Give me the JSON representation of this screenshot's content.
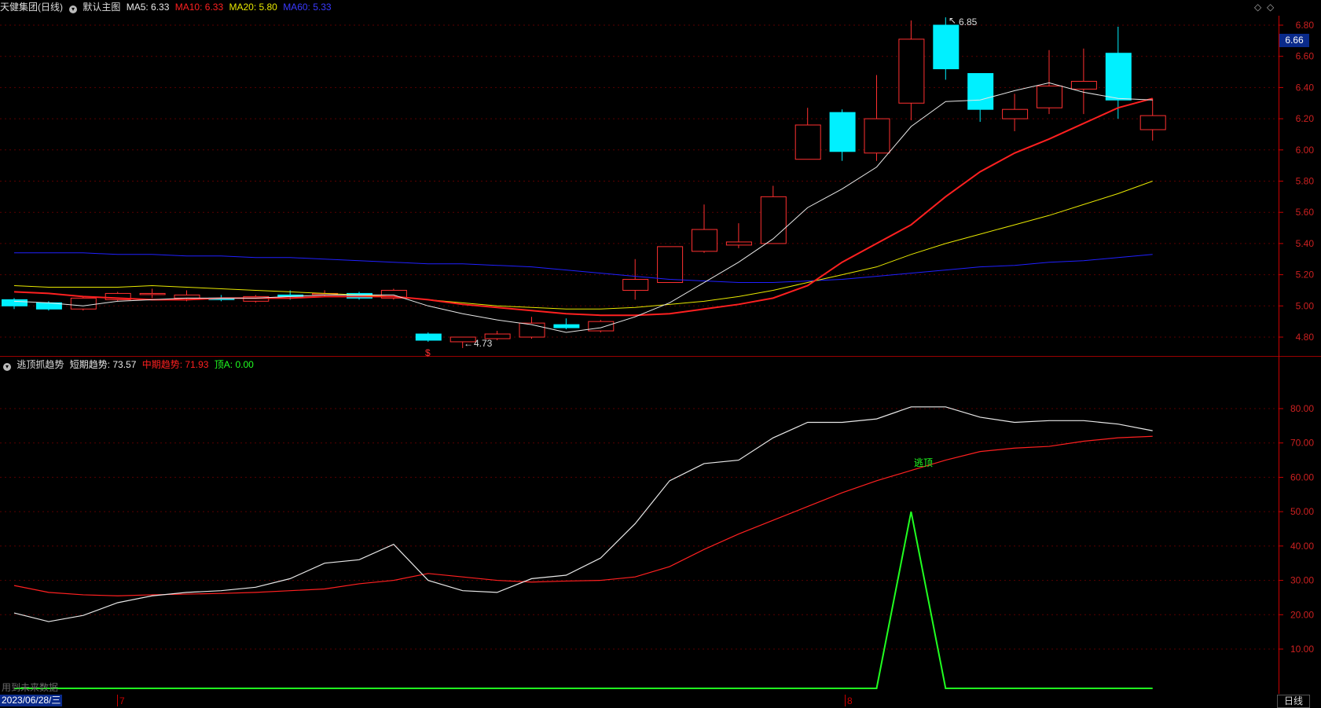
{
  "main_header": {
    "title": "天健集团(日线)",
    "indicator_name": "默认主图",
    "ma5": "MA5: 6.33",
    "ma10": "MA10: 6.33",
    "ma20": "MA20: 5.80",
    "ma60": "MA60: 5.33"
  },
  "sub_header": {
    "indicator_name": "逃顶抓趋势",
    "short_trend": "短期趋势: 73.57",
    "mid_trend": "中期趋势: 71.93",
    "top_a": "顶A: 0.00"
  },
  "colors": {
    "ma5": "#e8e8e8",
    "ma10": "#ff2020",
    "ma20": "#e8e800",
    "ma60": "#2020ff",
    "up": "#ff3030",
    "down": "#00f0ff",
    "signal": "#20ff20",
    "axis": "#cc0000"
  },
  "icons": [
    "chevron-down-icon",
    "diamond-icon"
  ],
  "price_axis_labels": [
    "6.80",
    "6.60",
    "6.40",
    "6.20",
    "6.00",
    "5.80",
    "5.60",
    "5.40",
    "5.20",
    "5.00",
    "4.80"
  ],
  "indicator_axis_labels": [
    "80.00",
    "70.00",
    "60.00",
    "50.00",
    "40.00",
    "30.00",
    "20.00",
    "10.00"
  ],
  "current_price_tag": "6.66",
  "high_marker": "6.85",
  "low_marker": "4.73",
  "low_signal_mark": "$",
  "signal_label": "逃顶",
  "footer_text": "用到未来数据",
  "date_label": "2023/06/28/三",
  "month_marks": [
    "7",
    "8"
  ],
  "period_button": "日线",
  "chart_data": [
    {
      "type": "candlestick",
      "ylim": [
        4.66,
        6.86
      ],
      "candles": [
        {
          "o": 5.04,
          "c": 5.0,
          "h": 5.05,
          "l": 4.98
        },
        {
          "o": 5.02,
          "c": 4.98,
          "h": 5.03,
          "l": 4.97
        },
        {
          "o": 4.98,
          "c": 5.05,
          "h": 5.06,
          "l": 4.97
        },
        {
          "o": 5.04,
          "c": 5.08,
          "h": 5.09,
          "l": 5.03
        },
        {
          "o": 5.08,
          "c": 5.08,
          "h": 5.11,
          "l": 5.05
        },
        {
          "o": 5.05,
          "c": 5.07,
          "h": 5.1,
          "l": 5.03
        },
        {
          "o": 5.05,
          "c": 5.04,
          "h": 5.07,
          "l": 5.03
        },
        {
          "o": 5.03,
          "c": 5.06,
          "h": 5.07,
          "l": 5.02
        },
        {
          "o": 5.07,
          "c": 5.06,
          "h": 5.1,
          "l": 5.04
        },
        {
          "o": 5.08,
          "c": 5.08,
          "h": 5.1,
          "l": 5.06
        },
        {
          "o": 5.08,
          "c": 5.05,
          "h": 5.09,
          "l": 5.04
        },
        {
          "o": 5.05,
          "c": 5.1,
          "h": 5.11,
          "l": 5.04
        },
        {
          "o": 4.82,
          "c": 4.78,
          "h": 4.83,
          "l": 4.77
        },
        {
          "o": 4.77,
          "c": 4.8,
          "h": 4.8,
          "l": 4.73
        },
        {
          "o": 4.79,
          "c": 4.82,
          "h": 4.84,
          "l": 4.78
        },
        {
          "o": 4.8,
          "c": 4.89,
          "h": 4.93,
          "l": 4.79
        },
        {
          "o": 4.88,
          "c": 4.86,
          "h": 4.92,
          "l": 4.85
        },
        {
          "o": 4.84,
          "c": 4.9,
          "h": 4.91,
          "l": 4.83
        },
        {
          "o": 5.1,
          "c": 5.17,
          "h": 5.3,
          "l": 5.04
        },
        {
          "o": 5.15,
          "c": 5.38,
          "h": 5.38,
          "l": 5.15
        },
        {
          "o": 5.35,
          "c": 5.49,
          "h": 5.65,
          "l": 5.34
        },
        {
          "o": 5.39,
          "c": 5.41,
          "h": 5.53,
          "l": 5.37
        },
        {
          "o": 5.4,
          "c": 5.7,
          "h": 5.77,
          "l": 5.4
        },
        {
          "o": 5.94,
          "c": 6.16,
          "h": 6.27,
          "l": 5.94
        },
        {
          "o": 6.24,
          "c": 5.99,
          "h": 6.26,
          "l": 5.93
        },
        {
          "o": 5.98,
          "c": 6.2,
          "h": 6.48,
          "l": 5.93
        },
        {
          "o": 6.3,
          "c": 6.71,
          "h": 6.83,
          "l": 6.19
        },
        {
          "o": 6.8,
          "c": 6.52,
          "h": 6.85,
          "l": 6.45
        },
        {
          "o": 6.49,
          "c": 6.26,
          "h": 6.49,
          "l": 6.18
        },
        {
          "o": 6.2,
          "c": 6.26,
          "h": 6.36,
          "l": 6.12
        },
        {
          "o": 6.27,
          "c": 6.41,
          "h": 6.64,
          "l": 6.23
        },
        {
          "o": 6.39,
          "c": 6.44,
          "h": 6.65,
          "l": 6.23
        },
        {
          "o": 6.62,
          "c": 6.32,
          "h": 6.79,
          "l": 6.2
        },
        {
          "o": 6.13,
          "c": 6.22,
          "h": 6.33,
          "l": 6.06
        }
      ],
      "ma5": [
        5.03,
        5.02,
        5.0,
        5.03,
        5.04,
        5.05,
        5.05,
        5.05,
        5.06,
        5.07,
        5.07,
        5.07,
        5.0,
        4.95,
        4.91,
        4.88,
        4.83,
        4.86,
        4.93,
        5.02,
        5.15,
        5.28,
        5.43,
        5.63,
        5.75,
        5.89,
        6.15,
        6.31,
        6.32,
        6.38,
        6.43,
        6.37,
        6.33,
        6.32
      ],
      "ma10": [
        5.09,
        5.08,
        5.06,
        5.05,
        5.04,
        5.04,
        5.05,
        5.05,
        5.05,
        5.06,
        5.06,
        5.06,
        5.04,
        5.01,
        4.99,
        4.97,
        4.95,
        4.94,
        4.94,
        4.95,
        4.98,
        5.01,
        5.05,
        5.13,
        5.28,
        5.4,
        5.52,
        5.7,
        5.86,
        5.98,
        6.07,
        6.17,
        6.27,
        6.33
      ],
      "ma20": [
        5.13,
        5.12,
        5.12,
        5.12,
        5.13,
        5.12,
        5.11,
        5.1,
        5.09,
        5.08,
        5.07,
        5.06,
        5.04,
        5.02,
        5.0,
        4.99,
        4.98,
        4.98,
        4.99,
        5.01,
        5.03,
        5.06,
        5.1,
        5.15,
        5.2,
        5.25,
        5.33,
        5.4,
        5.46,
        5.52,
        5.58,
        5.65,
        5.72,
        5.8
      ],
      "ma60": [
        5.34,
        5.34,
        5.34,
        5.33,
        5.33,
        5.32,
        5.32,
        5.31,
        5.31,
        5.3,
        5.29,
        5.28,
        5.27,
        5.27,
        5.26,
        5.25,
        5.23,
        5.21,
        5.19,
        5.17,
        5.16,
        5.15,
        5.15,
        5.16,
        5.17,
        5.19,
        5.21,
        5.23,
        5.25,
        5.26,
        5.28,
        5.29,
        5.31,
        5.33
      ]
    },
    {
      "type": "line",
      "ylim": [
        0,
        85
      ],
      "series": [
        {
          "name": "短期趋势",
          "values": [
            20.5,
            18.0,
            19.8,
            23.5,
            25.5,
            26.5,
            27.0,
            28.0,
            30.5,
            35.0,
            36.0,
            40.5,
            30.0,
            27.0,
            26.5,
            30.5,
            31.5,
            36.5,
            46.5,
            59.0,
            64.0,
            65.0,
            71.5,
            76.0,
            76.0,
            77.0,
            80.5,
            80.5,
            77.5,
            76.0,
            76.5,
            76.5,
            75.5,
            73.57
          ]
        },
        {
          "name": "中期趋势",
          "values": [
            28.5,
            26.5,
            25.8,
            25.5,
            25.8,
            26.0,
            26.2,
            26.5,
            27.0,
            27.5,
            29.0,
            30.0,
            32.0,
            31.0,
            30.0,
            29.5,
            29.8,
            30.0,
            31.0,
            34.0,
            39.0,
            43.5,
            47.5,
            51.5,
            55.5,
            59.0,
            62.0,
            65.0,
            67.5,
            68.5,
            69.0,
            70.5,
            71.5,
            71.93
          ]
        },
        {
          "name": "顶A",
          "values": [
            0,
            0,
            0,
            0,
            0,
            0,
            0,
            0,
            0,
            0,
            0,
            0,
            0,
            0,
            0,
            0,
            0,
            0,
            0,
            0,
            0,
            0,
            0,
            0,
            0,
            0,
            50,
            0,
            0,
            0,
            0,
            0,
            0,
            0
          ]
        }
      ]
    }
  ]
}
